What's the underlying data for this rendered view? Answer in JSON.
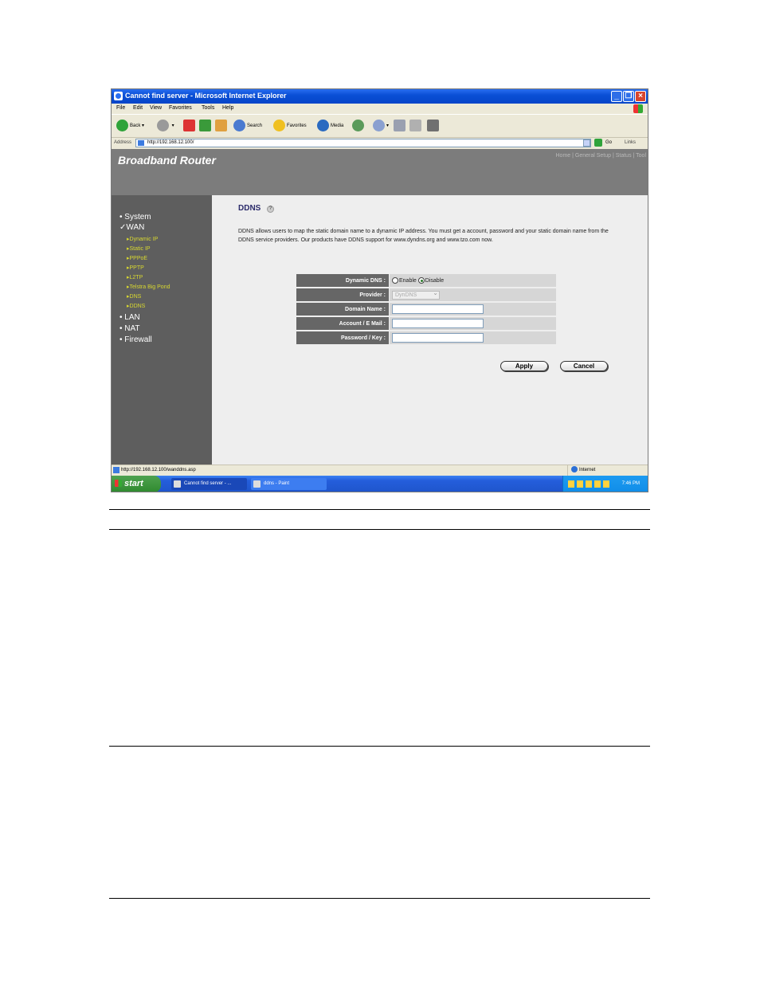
{
  "window": {
    "title": "Cannot find server - Microsoft Internet Explorer"
  },
  "menu": [
    "File",
    "Edit",
    "View",
    "Favorites",
    "Tools",
    "Help"
  ],
  "toolbar": {
    "back": "Back",
    "search": "Search",
    "favorites": "Favorites",
    "media": "Media"
  },
  "address": {
    "label": "Address",
    "url": "http://192.168.12.100/",
    "go": "Go",
    "links": "Links"
  },
  "router": {
    "brand": "Broadband Router",
    "top_links": "Home | General Setup | Status | Tool",
    "nav": {
      "system": "System",
      "wan": "WAN",
      "wan_sub": [
        "Dynamic IP",
        "Static IP",
        "PPPoE",
        "PPTP",
        "L2TP",
        "Telstra Big Pond",
        "DNS",
        "DDNS"
      ],
      "lan": "LAN",
      "nat": "NAT",
      "firewall": "Firewall"
    },
    "page": {
      "title": "DDNS",
      "help": "?",
      "description": "DDNS allows users to map the static domain name to a dynamic IP address. You must get a account, password and your static domain name from the DDNS service providers. Our products have DDNS support for www.dyndns.org and www.tzo.com now."
    },
    "form": {
      "dynamic_dns_label": "Dynamic DNS :",
      "enable": "Enable",
      "disable": "Disable",
      "provider_label": "Provider :",
      "provider_value": "DynDNS",
      "domain_label": "Domain Name :",
      "account_label": "Account / E Mail :",
      "password_label": "Password / Key :"
    },
    "buttons": {
      "apply": "Apply",
      "cancel": "Cancel"
    }
  },
  "status": {
    "url": "http://192.168.12.100/wanddns.asp",
    "zone": "Internet"
  },
  "taskbar": {
    "start": "start",
    "task1": "Cannot find server - ...",
    "task2": "ddns - Paint",
    "clock": "7:46 PM"
  }
}
